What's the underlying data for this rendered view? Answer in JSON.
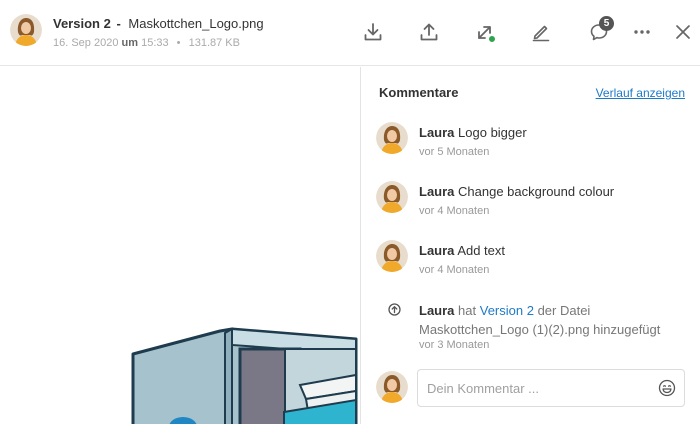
{
  "header": {
    "version_label": "Version 2",
    "separator": "-",
    "file_name": "Maskottchen_Logo.png",
    "date": "16. Sep 2020",
    "time_word": "um",
    "time": "15:33",
    "dot": "•",
    "file_size": "131.87 KB"
  },
  "toolbar": {
    "download_icon": "download-icon",
    "upload_icon": "upload-icon",
    "share_icon": "share-link-icon",
    "edit_icon": "pencil-icon",
    "comments_icon": "comment-icon",
    "comments_count": "5",
    "more_icon": "more-icon",
    "close_icon": "close-icon"
  },
  "comments_panel": {
    "title": "Kommentare",
    "history_link": "Verlauf anzeigen",
    "comments": [
      {
        "author": "Laura",
        "text": "Logo bigger",
        "time": "vor 5 Monaten"
      },
      {
        "author": "Laura",
        "text": "Change background colour",
        "time": "vor 4 Monaten"
      },
      {
        "author": "Laura",
        "text": "Add text",
        "time": "vor 4 Monaten"
      }
    ],
    "version_event": {
      "author": "Laura",
      "pre": "hat",
      "version_link": "Version 2",
      "post": "der Datei",
      "file": "Maskottchen_Logo (1)(2).png hinzugefügt",
      "time": "vor 3 Monaten"
    },
    "input": {
      "placeholder": "Dein Kommentar ..."
    }
  },
  "colors": {
    "link": "#1e7ac8",
    "badge": "#555555",
    "status_dot": "#2ea44f"
  }
}
